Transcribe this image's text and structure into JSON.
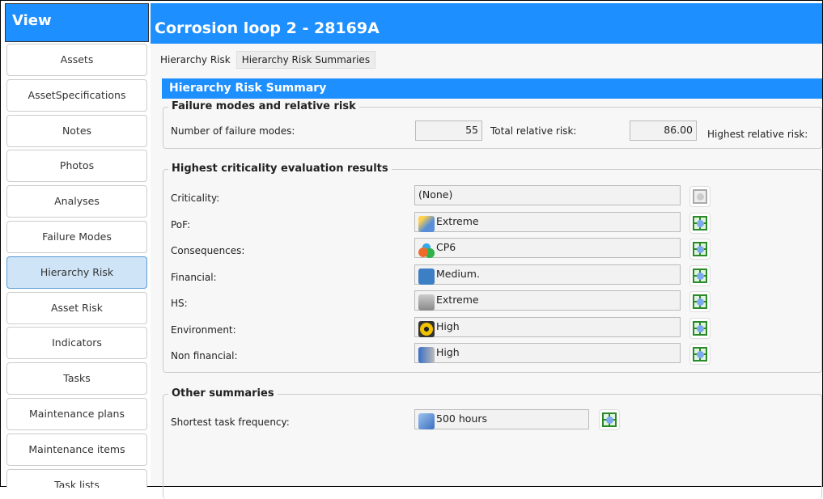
{
  "sidebar": {
    "header": "View",
    "items": [
      {
        "label": "Assets"
      },
      {
        "label": "AssetSpecifications"
      },
      {
        "label": "Notes"
      },
      {
        "label": "Photos"
      },
      {
        "label": "Analyses"
      },
      {
        "label": "Failure Modes"
      },
      {
        "label": "Hierarchy Risk",
        "active": true
      },
      {
        "label": "Asset Risk"
      },
      {
        "label": "Indicators"
      },
      {
        "label": "Tasks"
      },
      {
        "label": "Maintenance plans"
      },
      {
        "label": "Maintenance items"
      },
      {
        "label": "Task lists"
      }
    ]
  },
  "header": {
    "title": "Corrosion loop 2 - 28169A"
  },
  "tabs": [
    {
      "label": "Hierarchy Risk"
    },
    {
      "label": "Hierarchy Risk Summaries"
    }
  ],
  "panel": {
    "title": "Hierarchy Risk Summary"
  },
  "failure": {
    "title": "Failure modes and relative risk",
    "num_label": "Number of failure modes:",
    "num_value": "55",
    "total_label": "Total relative risk:",
    "total_value": "86.00",
    "highest_label": "Highest relative risk:"
  },
  "criticality": {
    "title": "Highest criticality evaluation results",
    "rows": [
      {
        "label": "Criticality:",
        "value": "(None)",
        "icon": "none"
      },
      {
        "label": "PoF:",
        "value": "Extreme",
        "icon": "calendar-clock-icon"
      },
      {
        "label": "Consequences:",
        "value": "CP6",
        "icon": "spheres-icon"
      },
      {
        "label": "Financial:",
        "value": "Medium.",
        "icon": "dollar-icon"
      },
      {
        "label": "HS:",
        "value": "Extreme",
        "icon": "first-aid-kit-icon"
      },
      {
        "label": "Environment:",
        "value": "High",
        "icon": "radiation-icon"
      },
      {
        "label": "Non financial:",
        "value": "High",
        "icon": "speaker-icon"
      }
    ]
  },
  "other": {
    "title": "Other summaries",
    "label": "Shortest task frequency:",
    "value": "500 hours"
  },
  "colors": {
    "accent": "#1e8fff"
  }
}
